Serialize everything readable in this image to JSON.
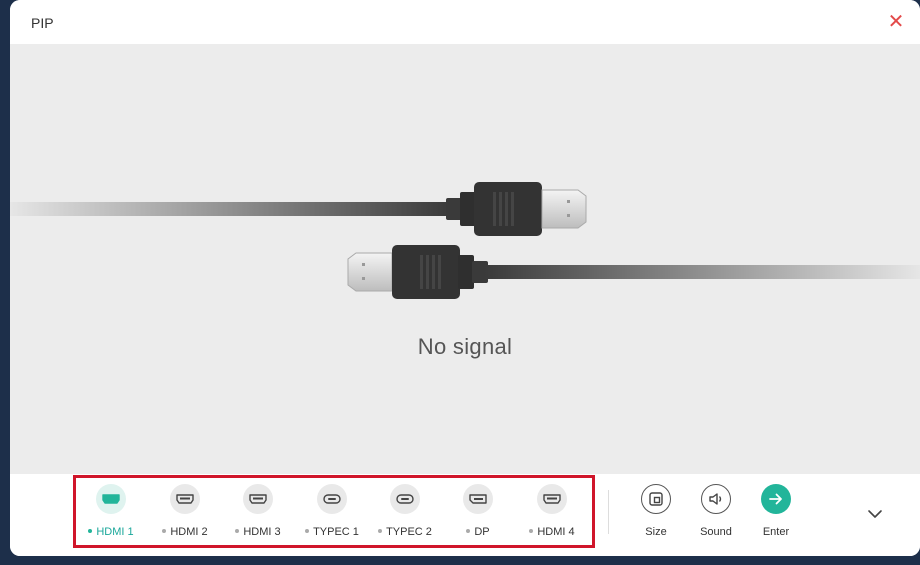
{
  "window": {
    "title": "PIP"
  },
  "stage": {
    "message": "No signal"
  },
  "sources": [
    {
      "label": "HDMI 1",
      "icon": "hdmi-port-icon",
      "active": true
    },
    {
      "label": "HDMI 2",
      "icon": "hdmi-port-icon",
      "active": false
    },
    {
      "label": "HDMI 3",
      "icon": "hdmi-port-icon",
      "active": false
    },
    {
      "label": "TYPEC 1",
      "icon": "usb-c-port-icon",
      "active": false
    },
    {
      "label": "TYPEC 2",
      "icon": "usb-c-port-icon",
      "active": false
    },
    {
      "label": "DP",
      "icon": "displayport-icon",
      "active": false
    },
    {
      "label": "HDMI 4",
      "icon": "hdmi-port-icon",
      "active": false
    }
  ],
  "tools": [
    {
      "label": "Size",
      "icon": "size-icon"
    },
    {
      "label": "Sound",
      "icon": "sound-icon"
    },
    {
      "label": "Enter",
      "icon": "enter-arrow-icon"
    }
  ],
  "colors": {
    "accent": "#22b59a",
    "active_label": "#1aa79a",
    "close": "#e34a4a",
    "highlight_border": "#d0152a"
  }
}
